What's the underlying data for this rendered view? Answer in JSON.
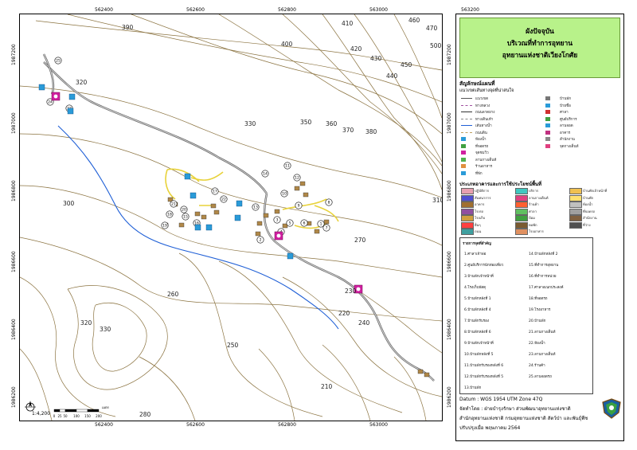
{
  "map": {
    "x_ticks": [
      "562400",
      "562600",
      "562800",
      "563000",
      "563200"
    ],
    "y_ticks": [
      "1987200",
      "1987000",
      "1986800",
      "1986600",
      "1986400",
      "1986200"
    ],
    "contour_labels": [
      "390",
      "400",
      "410",
      "420",
      "430",
      "440",
      "450",
      "460",
      "470",
      "500",
      "320",
      "330",
      "350",
      "360",
      "370",
      "380",
      "300",
      "310",
      "270",
      "260",
      "250",
      "240",
      "230",
      "220",
      "210",
      "280",
      "330",
      "320"
    ],
    "scale_text": "1:4,200",
    "scale_ticks": [
      "0",
      "25",
      "50",
      "100",
      "150",
      "200"
    ],
    "scale_unit": "เมตร",
    "poi_numbers": [
      "1",
      "2",
      "3",
      "4",
      "5",
      "6",
      "7",
      "8",
      "9",
      "10",
      "11",
      "12",
      "13",
      "14",
      "15",
      "16",
      "17",
      "18",
      "19",
      "20",
      "21",
      "22",
      "23",
      "24",
      "25"
    ],
    "colors": {
      "contour": "#8b7340",
      "river": "#1f5fd6",
      "road": "#777777",
      "yellow_path": "#e8d23a",
      "poi_blue": "#2a9bd8",
      "poi_magenta": "#d020a0"
    }
  },
  "side": {
    "title_lines": [
      "ผังปัจจุบัน",
      "บริเวณที่ทำการอุทยาน",
      "อุทยานแห่งชาติเวียงโกศัย"
    ],
    "legend_heading": "สัญลักษณ์แผนที่",
    "legend_sub": "แนวเขตเส้นทางจุดที่น่าสนใจ",
    "legend_items": [
      "แนวเขต",
      "ทางหลวง",
      "ถนนลาดยาง",
      "ทางเดินเท้า",
      "เส้นทางน้ำ",
      "ถนนดิน",
      "ห้องน้ำ",
      "ที่จอดรถ",
      "จุดชมวิว",
      "ลานกางเต็นท์",
      "ร้านอาหาร",
      "ที่พัก",
      "บ้านพัก",
      "ป้ายชื่อ",
      "ศาลา",
      "ศูนย์บริการ",
      "ลานจอด",
      "อาคาร",
      "สำนักงาน",
      "จุดกางเต็นท์"
    ],
    "landuse_heading": "ประเภทอาคารและการใช้ประโยชน์พื้นที่",
    "landuse": [
      {
        "label": "ปฏิบัติการ",
        "color": "#e8a0b0"
      },
      {
        "label": "บริการ",
        "color": "#40c8c0"
      },
      {
        "label": "บ้านพักเจ้าหน้าที่",
        "color": "#f0c050"
      },
      {
        "label": "สันทนาการ",
        "color": "#5050d0"
      },
      {
        "label": "ลานกางเต็นท์",
        "color": "#e04080"
      },
      {
        "label": "บ้านพัก",
        "color": "#ffe070"
      },
      {
        "label": "อาคาร",
        "color": "#a07030"
      },
      {
        "label": "ร้านค้า",
        "color": "#ff6030"
      },
      {
        "label": "ห้องน้ำ",
        "color": "#c0c0c0"
      },
      {
        "label": "โรงรถ",
        "color": "#9050a0"
      },
      {
        "label": "ศาลา",
        "color": "#60c060"
      },
      {
        "label": "ที่จอดรถ",
        "color": "#a0a0a0"
      },
      {
        "label": "โรงเก็บ",
        "color": "#d0a040"
      },
      {
        "label": "ป้อม",
        "color": "#40a040"
      },
      {
        "label": "สำนักงาน",
        "color": "#806040"
      },
      {
        "label": "อื่นๆ",
        "color": "#ff4040"
      },
      {
        "label": "หอพัก",
        "color": "#7a5a30"
      },
      {
        "label": "ที่ว่าง",
        "color": "#505050"
      },
      {
        "label": "ถนน",
        "color": "#40a0a0"
      },
      {
        "label": "โรงอาหาร",
        "color": "#e09060"
      }
    ],
    "places_heading": "รายการจุดที่สำคัญ",
    "places_left": [
      "1.ศาลาเจ้าพ่อ",
      "2.ศูนย์บริการนักท่องเที่ยว",
      "3.บ้านพักเจ้าหน้าที่",
      "4.โรงเก็บพัสดุ",
      "5.บ้านพักหลังที่ 1",
      "6.บ้านพักหลังที่ 4",
      "7.บ้านพักรับรอง",
      "8.บ้านพักหลังที่ 6",
      "9.บ้านพักเจ้าหน้าที่",
      "10.บ้านพักหลังที่ 5",
      "11.บ้านพักรับรองหลังที่ 6",
      "12.บ้านพักรับรองหลังที่ 5",
      "13.บ้านพัก"
    ],
    "places_right": [
      "14.บ้านพักหลังที่ 2",
      "15.ที่ทำการอุทยาน",
      "16.ที่ทำการหน่วย",
      "17.ศาลาอเนกประสงค์",
      "18.ที่จอดรถ",
      "19.โรงอาหาร",
      "20.บ้านพัก",
      "21.ลานกางเต็นท์",
      "22.ห้องน้ำ",
      "23.ลานกางเต็นท์",
      "24.ร้านค้า",
      "25.ลานจอดรถ"
    ],
    "footer": {
      "datum": "Datum  : WGS 1954 UTM Zone 47Q",
      "made_by": "จัดทำโดย  : ฝ่ายบำรุงรักษา ส่วนพัฒนาอุทยานแห่งชาติ",
      "office": "สำนักอุทยานแห่งชาติ  กรมอุทยานแห่งชาติ สัตว์ป่า และพันธุ์พืช",
      "updated": "ปรับปรุงเมื่อ  พฤษภาคม 2564"
    }
  }
}
